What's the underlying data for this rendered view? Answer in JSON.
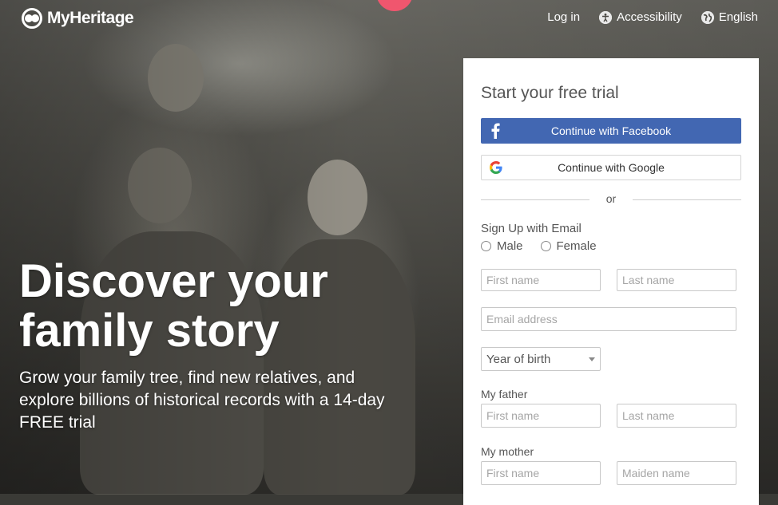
{
  "brand": {
    "name": "MyHeritage"
  },
  "topnav": {
    "login": "Log in",
    "accessibility": "Accessibility",
    "language": "English"
  },
  "hero": {
    "headline_line1": "Discover your",
    "headline_line2": "family story",
    "subline": "Grow your family tree, find new relatives, and explore billions of historical records with a 14-day FREE trial"
  },
  "signup": {
    "title": "Start your free trial",
    "facebook_button": "Continue with Facebook",
    "google_button": "Continue with Google",
    "or": "or",
    "email_heading": "Sign Up with Email",
    "gender": {
      "male": "Male",
      "female": "Female"
    },
    "placeholders": {
      "first_name": "First name",
      "last_name": "Last name",
      "email": "Email address",
      "maiden_name": "Maiden name"
    },
    "year_of_birth": "Year of birth",
    "father_label": "My father",
    "mother_label": "My mother"
  },
  "colors": {
    "facebook": "#4267b2",
    "badge": "#f0566e",
    "text_gray": "#555555"
  },
  "icons": {
    "logo": "myheritage-logo-icon",
    "accessibility": "accessibility-icon",
    "language": "globe-icon",
    "facebook": "facebook-icon",
    "google": "google-icon",
    "select": "chevron-down-icon"
  }
}
